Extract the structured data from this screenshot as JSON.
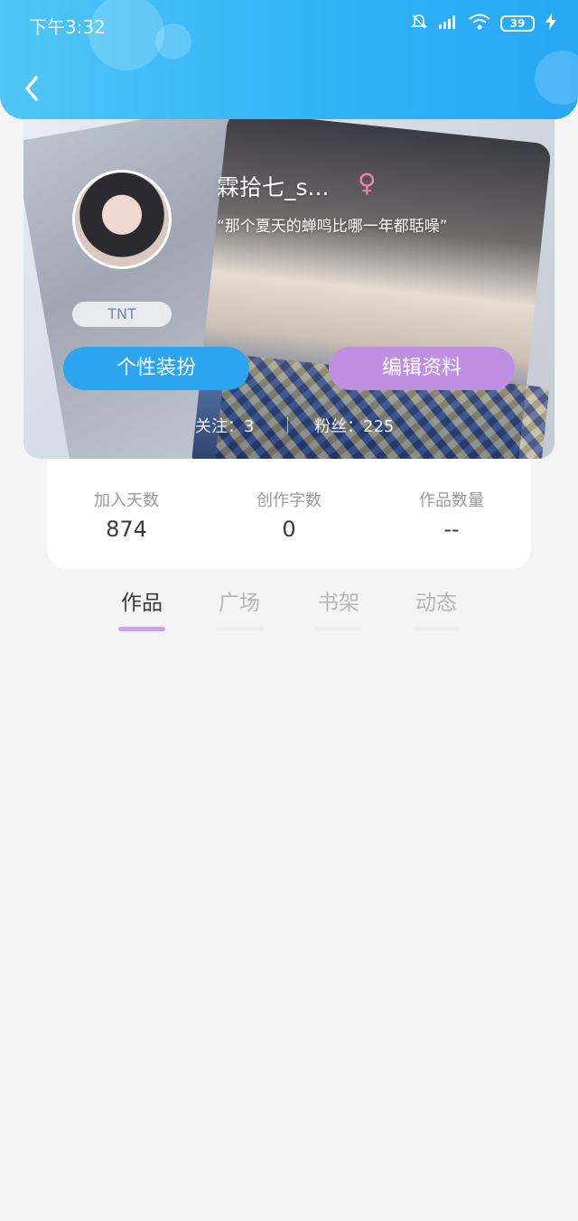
{
  "status_bar": {
    "time": "下午3:32",
    "battery": "39"
  },
  "profile": {
    "name": "霖拾七_s...",
    "gender_symbol": "♀",
    "signature": "“那个夏天的蝉鸣比哪一年都聒噪”",
    "tag": "TNT",
    "decorate_button": "个性装扮",
    "edit_button": "编辑资料",
    "follow": "关注：3",
    "fans": "粉丝：225"
  },
  "stats": [
    {
      "label": "加入天数",
      "value": "874"
    },
    {
      "label": "创作字数",
      "value": "0"
    },
    {
      "label": "作品数量",
      "value": "--"
    }
  ],
  "tabs": [
    {
      "label": "作品",
      "active": true
    },
    {
      "label": "广场",
      "active": false
    },
    {
      "label": "书架",
      "active": false
    },
    {
      "label": "动态",
      "active": false
    }
  ],
  "colors": {
    "header": "#2fb2f7",
    "decorate_button": "#2ba5f0",
    "edit_button": "#c08fe3",
    "tab_indicator": "#c5a6e6",
    "gender": "#f27db4"
  }
}
